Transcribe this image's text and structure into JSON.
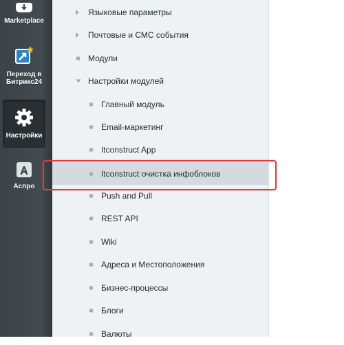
{
  "sidebar": {
    "items": [
      {
        "label": "Marketplace",
        "icon": "cloud-download-icon"
      },
      {
        "label": "Переход в Битрикс24",
        "icon": "external-link-icon"
      },
      {
        "label": "Настройки",
        "icon": "gear-icon",
        "active": true
      },
      {
        "label": "Аспро",
        "icon": "aspro-a-icon"
      }
    ]
  },
  "tree": {
    "items": [
      {
        "label": "Языковые параметры",
        "marker": "collapsed-arrow",
        "level": 1
      },
      {
        "label": "Почтовые и СМС события",
        "marker": "collapsed-arrow",
        "level": 1
      },
      {
        "label": "Модули",
        "marker": "bullet",
        "level": 1
      },
      {
        "label": "Настройки модулей",
        "marker": "expanded-arrow",
        "level": 1
      },
      {
        "label": "Главный модуль",
        "marker": "bullet",
        "level": 2
      },
      {
        "label": "Email-маркетинг",
        "marker": "bullet",
        "level": 2
      },
      {
        "label": "Itconstruct App",
        "marker": "bullet",
        "level": 2
      },
      {
        "label": "Itconstruct очистка инфоблоков",
        "marker": "bullet",
        "level": 2,
        "selected": true
      },
      {
        "label": "Push and Pull",
        "marker": "bullet",
        "level": 2
      },
      {
        "label": "REST API",
        "marker": "bullet",
        "level": 2
      },
      {
        "label": "Wiki",
        "marker": "bullet",
        "level": 2
      },
      {
        "label": "Адреса и Местоположения",
        "marker": "bullet",
        "level": 2
      },
      {
        "label": "Бизнес-процессы",
        "marker": "bullet",
        "level": 2
      },
      {
        "label": "Блоги",
        "marker": "bullet",
        "level": 2
      },
      {
        "label": "Валюты",
        "marker": "bullet",
        "level": 2
      }
    ]
  },
  "colors": {
    "sidebar_bg": "#434b50",
    "tree_bg": "#eef2f4",
    "selected_bg": "#d3dbe0",
    "highlight_border": "#e03b3b"
  }
}
